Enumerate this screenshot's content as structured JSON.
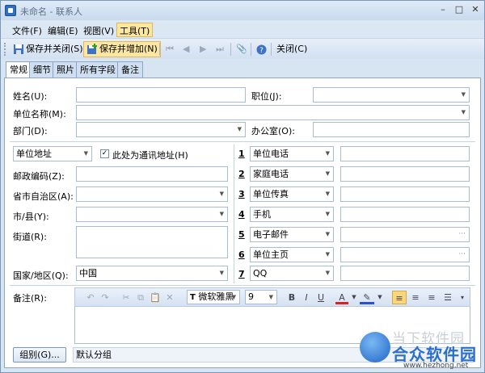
{
  "window": {
    "title": "未命名 - 联系人",
    "minimize": "–",
    "maximize": "□",
    "close": "✕"
  },
  "menu": [
    "文件(F)",
    "编辑(E)",
    "视图(V)",
    "工具(T)"
  ],
  "toolbar": {
    "save_close": "保存并关闭(S)",
    "save_new": "保存并增加(N)",
    "close": "关闭(C)"
  },
  "tabs": [
    "常规",
    "细节",
    "照片",
    "所有字段",
    "备注"
  ],
  "fields": {
    "name_label": "姓名(U):",
    "position_label": "职位(J):",
    "company_label": "单位名称(M):",
    "department_label": "部门(D):",
    "office_label": "办公室(O):",
    "address_type": "单位地址",
    "mailing_address_label": "此处为通讯地址(H)",
    "postal_label": "邮政编码(Z):",
    "province_label": "省市自治区(A):",
    "city_label": "市/县(Y):",
    "street_label": "街道(R):",
    "country_label": "国家/地区(Q):",
    "country_value": "中国"
  },
  "phones": [
    {
      "num": "1",
      "type": "单位电话"
    },
    {
      "num": "2",
      "type": "家庭电话"
    },
    {
      "num": "3",
      "type": "单位传真"
    },
    {
      "num": "4",
      "type": "手机"
    },
    {
      "num": "5",
      "type": "电子邮件"
    },
    {
      "num": "6",
      "type": "单位主页"
    },
    {
      "num": "7",
      "type": "QQ"
    }
  ],
  "notes": {
    "label": "备注(R):",
    "font": "微软雅黑",
    "size": "9",
    "bold": "B",
    "italic": "I",
    "underline": "U",
    "font_color": "A"
  },
  "group": {
    "button": "组别(G)...",
    "value": "默认分组"
  },
  "watermark": {
    "line1": "当下软件园",
    "line2": "合众软件园",
    "line3": "www.hezhong.net"
  }
}
